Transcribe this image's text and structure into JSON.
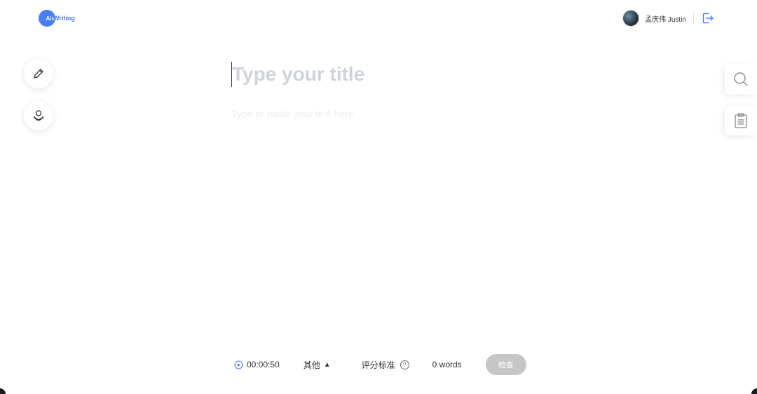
{
  "header": {
    "logo_badge": "Aim",
    "logo_text": "Writing",
    "username": "孟庆伟 Justin"
  },
  "editor": {
    "title_placeholder": "Type your title",
    "body_placeholder": "Type or paste your text here"
  },
  "bottom_bar": {
    "timer": "00:00:50",
    "other_label": "其他",
    "other_arrow": "▲",
    "criteria_label": "评分标准",
    "help_glyph": "?",
    "word_count": "0 words",
    "check_label": "检查"
  },
  "colors": {
    "brand_blue": "#4a7ef5",
    "check_disabled": "#c6c6c6"
  },
  "icons": [
    "pencil-icon",
    "user-hands-icon",
    "search-icon",
    "clipboard-icon",
    "logout-icon",
    "play-circle-icon",
    "help-circle-icon"
  ]
}
